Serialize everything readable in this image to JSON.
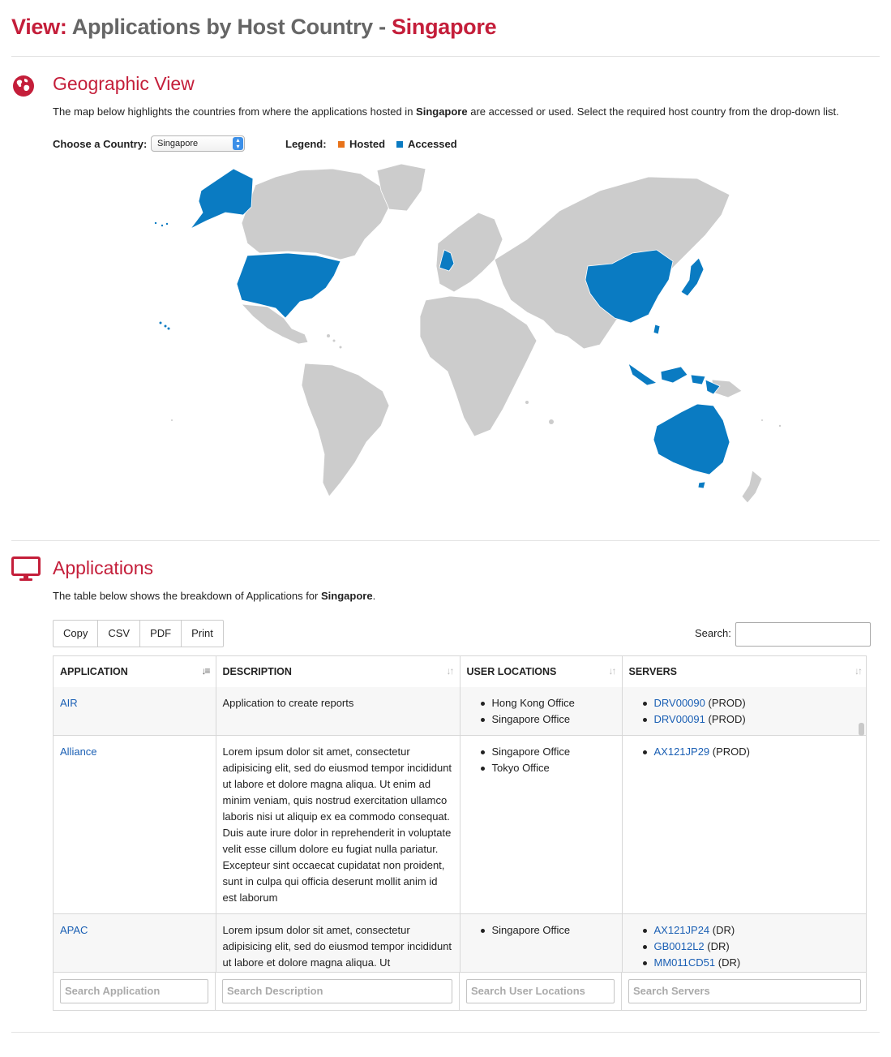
{
  "header": {
    "prefix": "View:",
    "middle": "Applications by Host Country -",
    "country": "Singapore"
  },
  "geo": {
    "heading": "Geographic View",
    "desc_before": "The map below highlights the countries from where the applications hosted in ",
    "desc_country": "Singapore",
    "desc_after": " are accessed or used. Select the required host country from the drop-down list.",
    "choose_label": "Choose a Country:",
    "selected_country": "Singapore",
    "legend_label": "Legend:",
    "legend_hosted": "Hosted",
    "legend_accessed": "Accessed",
    "colors": {
      "hosted": "#e8731a",
      "accessed": "#0a7bc2",
      "land": "#cccccc",
      "accent": "#c41e3a"
    },
    "icon": "globe-icon"
  },
  "apps": {
    "heading": "Applications",
    "desc_before": "The table below shows the breakdown of Applications for ",
    "desc_country": "Singapore",
    "desc_after": ".",
    "icon": "monitor-icon",
    "buttons": {
      "copy": "Copy",
      "csv": "CSV",
      "pdf": "PDF",
      "print": "Print"
    },
    "search_label": "Search:",
    "columns": [
      "APPLICATION",
      "DESCRIPTION",
      "USER LOCATIONS",
      "SERVERS"
    ],
    "rows": [
      {
        "application": "AIR",
        "description": "Application to create reports",
        "locations": [
          "Hong Kong Office",
          "Singapore Office"
        ],
        "servers": [
          {
            "name": "DRV00090",
            "env": "(PROD)"
          },
          {
            "name": "DRV00091",
            "env": "(PROD)"
          }
        ]
      },
      {
        "application": "Alliance",
        "description": "Lorem ipsum dolor sit amet, consectetur adipisicing elit, sed do eiusmod tempor incididunt ut labore et dolore magna aliqua. Ut enim ad minim veniam, quis nostrud exercitation ullamco laboris nisi ut aliquip ex ea commodo consequat. Duis aute irure dolor in reprehenderit in voluptate velit esse cillum dolore eu fugiat nulla pariatur. Excepteur sint occaecat cupidatat non proident, sunt in culpa qui officia deserunt mollit anim id est laborum",
        "locations": [
          "Singapore Office",
          "Tokyo Office"
        ],
        "servers": [
          {
            "name": "AX121JP29",
            "env": "(PROD)"
          }
        ]
      },
      {
        "application": "APAC",
        "description": "Lorem ipsum dolor sit amet, consectetur adipisicing elit, sed do eiusmod tempor incididunt ut labore et dolore magna aliqua. Ut",
        "locations": [
          "Singapore Office"
        ],
        "servers": [
          {
            "name": "AX121JP24",
            "env": "(DR)"
          },
          {
            "name": "GB0012L2",
            "env": "(DR)"
          },
          {
            "name": "MM011CD51",
            "env": "(DR)"
          }
        ]
      }
    ],
    "placeholders": {
      "application": "Search Application",
      "description": "Search Description",
      "locations": "Search User Locations",
      "servers": "Search Servers"
    }
  }
}
